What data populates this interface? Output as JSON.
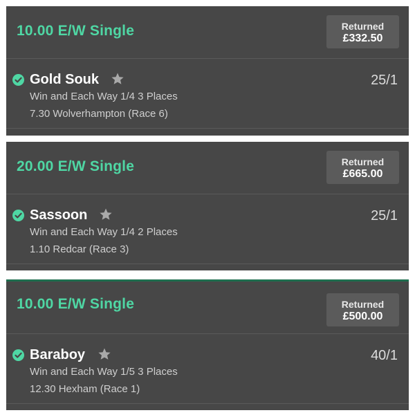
{
  "colors": {
    "accent_green": "#4fd7a4",
    "card_background": "#474747",
    "returned_box": "#5b5b5b",
    "divider_green": "#1f6e4f"
  },
  "bets": [
    {
      "title": "10.00 E/W Single",
      "returned_label": "Returned",
      "returned_amount": "£332.50",
      "selection": {
        "status_icon": "check-circle-icon",
        "favourite_icon": "star-icon",
        "name": "Gold Souk",
        "odds": "25/1",
        "market": "Win and Each Way 1/4 3 Places",
        "event": "7.30 Wolverhampton (Race 6)"
      }
    },
    {
      "title": "20.00 E/W Single",
      "returned_label": "Returned",
      "returned_amount": "£665.00",
      "selection": {
        "status_icon": "check-circle-icon",
        "favourite_icon": "star-icon",
        "name": "Sassoon",
        "odds": "25/1",
        "market": "Win and Each Way 1/4 2 Places",
        "event": "1.10 Redcar (Race 3)"
      }
    },
    {
      "title": "10.00 E/W Single",
      "returned_label": "Returned",
      "returned_amount": "£500.00",
      "selection": {
        "status_icon": "check-circle-icon",
        "favourite_icon": "star-icon",
        "name": "Baraboy",
        "odds": "40/1",
        "market": "Win and Each Way 1/5 3 Places",
        "event": "12.30 Hexham (Race 1)"
      }
    }
  ]
}
